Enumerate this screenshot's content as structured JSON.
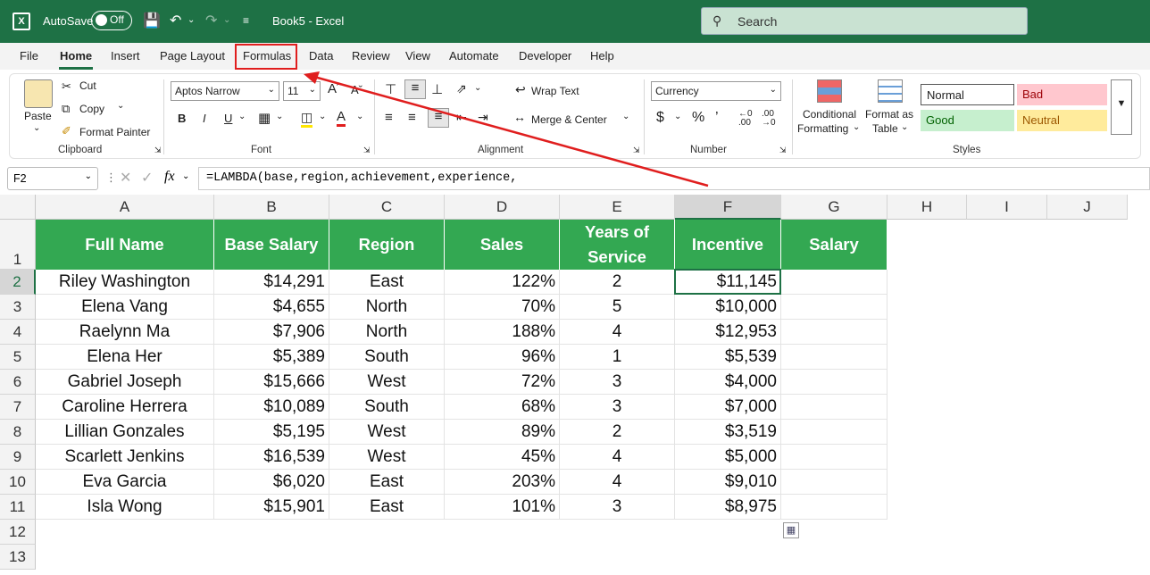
{
  "titlebar": {
    "autosave_label": "AutoSave",
    "autosave_state": "Off",
    "document_title": "Book5 - Excel",
    "search_placeholder": "Search"
  },
  "menu": {
    "tabs": [
      "File",
      "Home",
      "Insert",
      "Page Layout",
      "Formulas",
      "Data",
      "Review",
      "View",
      "Automate",
      "Developer",
      "Help"
    ],
    "active_tab": "Home",
    "highlighted_tab": "Formulas"
  },
  "ribbon": {
    "clipboard": {
      "paste": "Paste",
      "cut": "Cut",
      "copy": "Copy",
      "format_painter": "Format Painter",
      "label": "Clipboard"
    },
    "font": {
      "name": "Aptos Narrow",
      "size": "11",
      "label": "Font"
    },
    "alignment": {
      "wrap_text": "Wrap Text",
      "merge_center": "Merge & Center",
      "label": "Alignment"
    },
    "number": {
      "format": "Currency",
      "label": "Number"
    },
    "styles": {
      "conditional_formatting_1": "Conditional",
      "conditional_formatting_2": "Formatting",
      "format_as_table_1": "Format as",
      "format_as_table_2": "Table",
      "normal": "Normal",
      "bad": "Bad",
      "good": "Good",
      "neutral": "Neutral",
      "label": "Styles"
    }
  },
  "formula_bar": {
    "name_box": "F2",
    "fx": "fx",
    "formula": "=LAMBDA(base,region,achievement,experience,"
  },
  "columns": [
    "A",
    "B",
    "C",
    "D",
    "E",
    "F",
    "G",
    "H",
    "I",
    "J"
  ],
  "rows": [
    "1",
    "2",
    "3",
    "4",
    "5",
    "6",
    "7",
    "8",
    "9",
    "10",
    "11",
    "12",
    "13"
  ],
  "table": {
    "headers": [
      "Full Name",
      "Base Salary",
      "Region",
      "Sales",
      "Years of Service",
      "Incentive",
      "Salary"
    ],
    "header_color": "#33a852",
    "data": [
      [
        "Riley Washington",
        "$14,291",
        "East",
        "122%",
        "2",
        "$11,145",
        ""
      ],
      [
        "Elena Vang",
        "$4,655",
        "North",
        "70%",
        "5",
        "$10,000",
        ""
      ],
      [
        "Raelynn Ma",
        "$7,906",
        "North",
        "188%",
        "4",
        "$12,953",
        ""
      ],
      [
        "Elena Her",
        "$5,389",
        "South",
        "96%",
        "1",
        "$5,539",
        ""
      ],
      [
        "Gabriel Joseph",
        "$15,666",
        "West",
        "72%",
        "3",
        "$4,000",
        ""
      ],
      [
        "Caroline Herrera",
        "$10,089",
        "South",
        "68%",
        "3",
        "$7,000",
        ""
      ],
      [
        "Lillian Gonzales",
        "$5,195",
        "West",
        "89%",
        "2",
        "$3,519",
        ""
      ],
      [
        "Scarlett Jenkins",
        "$16,539",
        "West",
        "45%",
        "4",
        "$5,000",
        ""
      ],
      [
        "Eva Garcia",
        "$6,020",
        "East",
        "203%",
        "4",
        "$9,010",
        ""
      ],
      [
        "Isla Wong",
        "$15,901",
        "East",
        "101%",
        "3",
        "$8,975",
        ""
      ]
    ]
  },
  "selected_cell": "F2",
  "annotation_color": "#e01e1e"
}
